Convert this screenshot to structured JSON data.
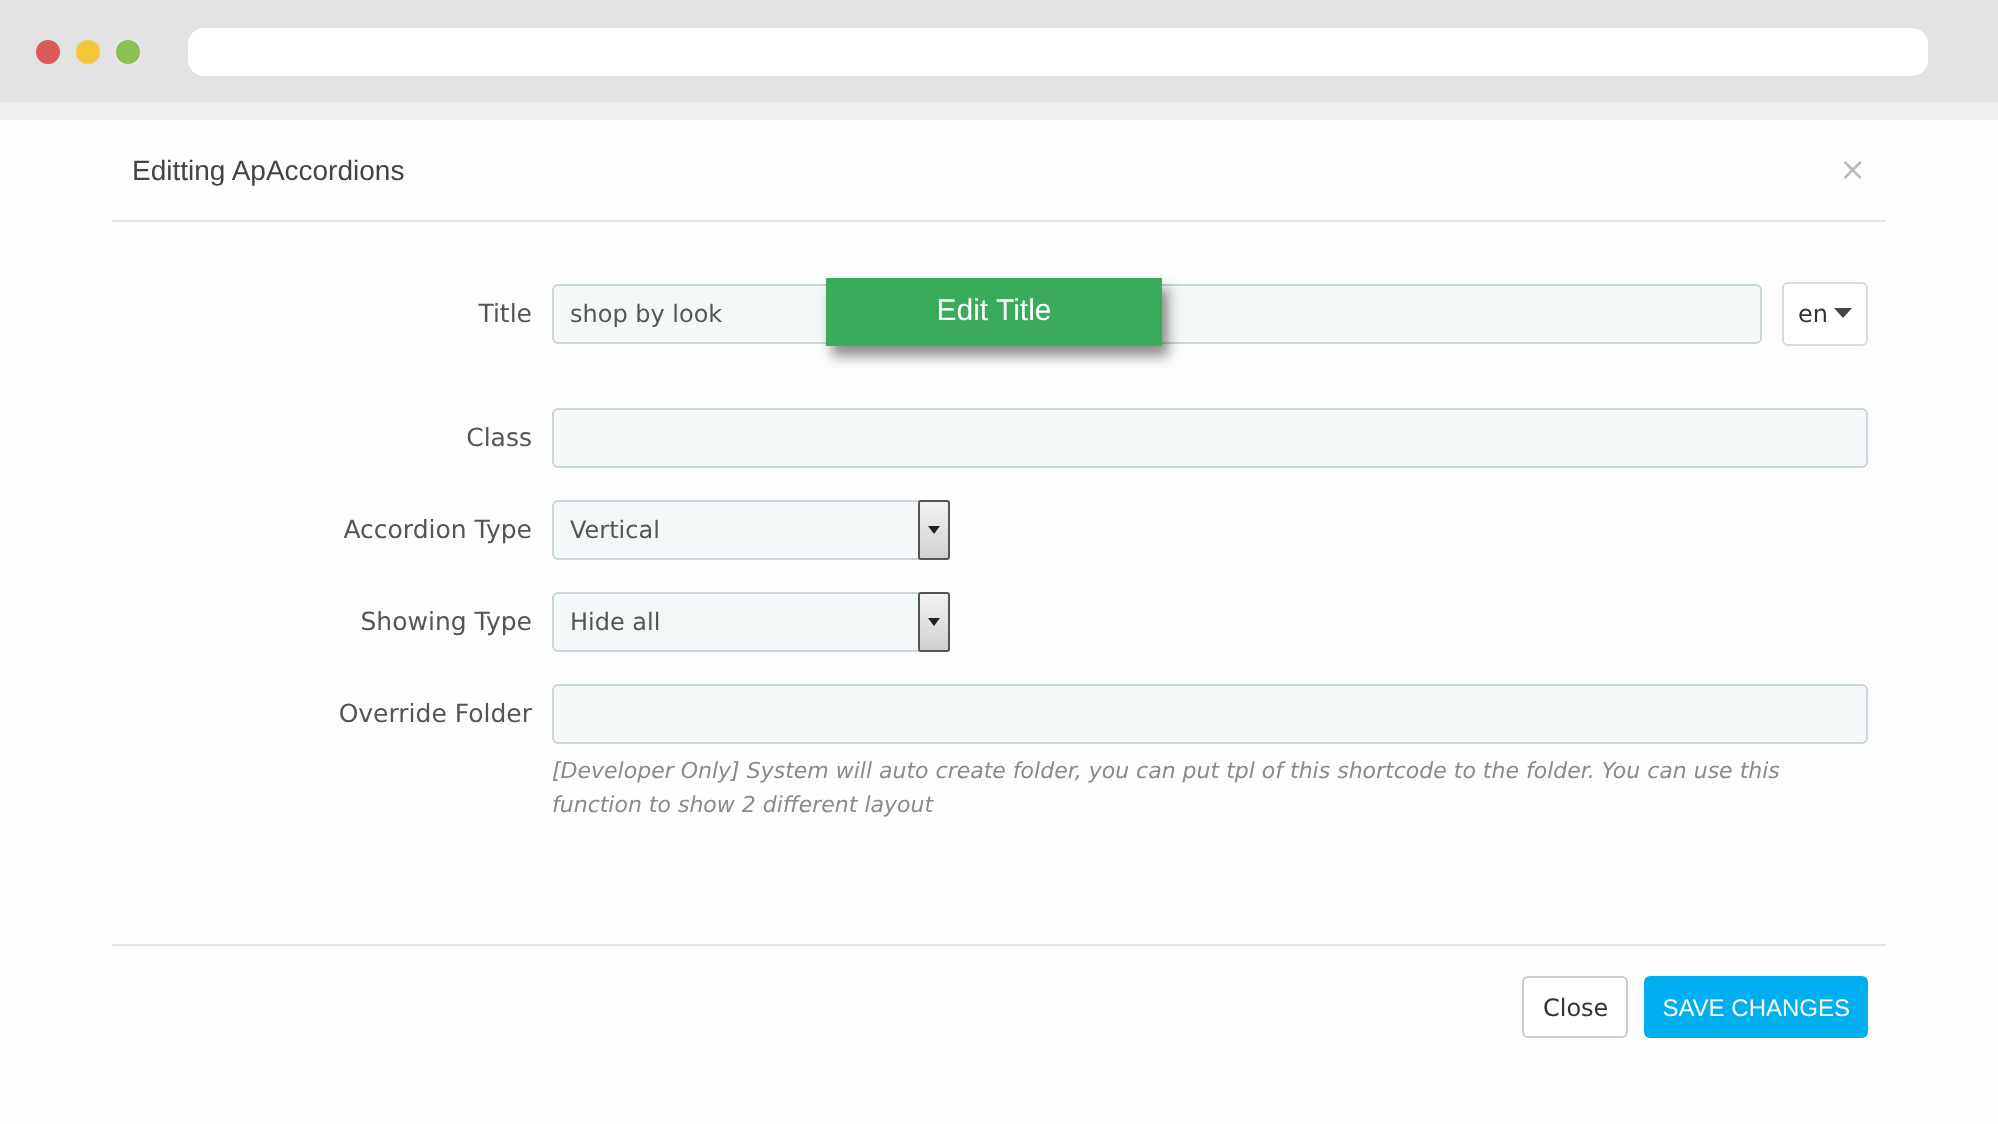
{
  "browser": {
    "dots": [
      {
        "color": "#dc5a5a"
      },
      {
        "color": "#f6c63a"
      },
      {
        "color": "#8cc152"
      }
    ]
  },
  "modal": {
    "title": "Editting ApAccordions",
    "close": "×",
    "fields": [
      {
        "kind": "text",
        "label": "Title",
        "value": "shop by look",
        "language": "en",
        "callout": "Edit Title"
      },
      {
        "kind": "text",
        "label": "Class"
      },
      {
        "kind": "select",
        "label": "Accordion Type",
        "value": "Vertical"
      },
      {
        "kind": "select",
        "label": "Showing Type",
        "value": "Hide all"
      },
      {
        "kind": "text",
        "label": "Override Folder",
        "help": "[Developer Only] System will auto create folder, you can put tpl of this shortcode to the folder. You can use this function to show 2 different layout"
      }
    ],
    "buttons": [
      {
        "kind": "secondary",
        "label": "Close"
      },
      {
        "kind": "primary",
        "label": "SAVE CHANGES"
      }
    ]
  }
}
